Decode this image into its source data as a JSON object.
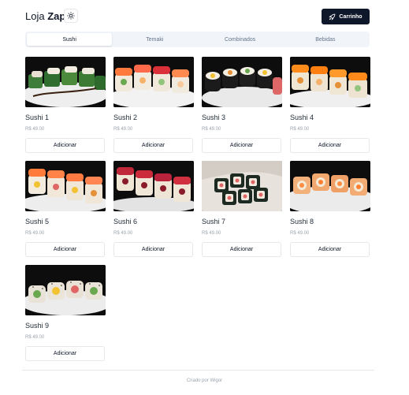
{
  "header": {
    "brand_prefix": "Loja",
    "brand_bold": "Zap",
    "cart_label": "Carrinho"
  },
  "tabs": [
    {
      "label": "Sushi",
      "active": true
    },
    {
      "label": "Temaki",
      "active": false
    },
    {
      "label": "Combinados",
      "active": false
    },
    {
      "label": "Bebidas",
      "active": false
    }
  ],
  "products": [
    {
      "name": "Sushi 1",
      "price": "R$ 49.00",
      "button": "Adicionar"
    },
    {
      "name": "Sushi 2",
      "price": "R$ 49.00",
      "button": "Adicionar"
    },
    {
      "name": "Sushi 3",
      "price": "R$ 49.00",
      "button": "Adicionar"
    },
    {
      "name": "Sushi 4",
      "price": "R$ 49.00",
      "button": "Adicionar"
    },
    {
      "name": "Sushi 5",
      "price": "R$ 49.00",
      "button": "Adicionar"
    },
    {
      "name": "Sushi 6",
      "price": "R$ 49.00",
      "button": "Adicionar"
    },
    {
      "name": "Sushi 7",
      "price": "R$ 49.00",
      "button": "Adicionar"
    },
    {
      "name": "Sushi 8",
      "price": "R$ 49.00",
      "button": "Adicionar"
    },
    {
      "name": "Sushi 9",
      "price": "R$ 49.00",
      "button": "Adicionar"
    }
  ],
  "footer": {
    "text": "Criado por Wigor"
  },
  "colors": {
    "primary": "#0f172a",
    "tab_bg": "#f1f5f9",
    "muted": "#9ca3af"
  }
}
